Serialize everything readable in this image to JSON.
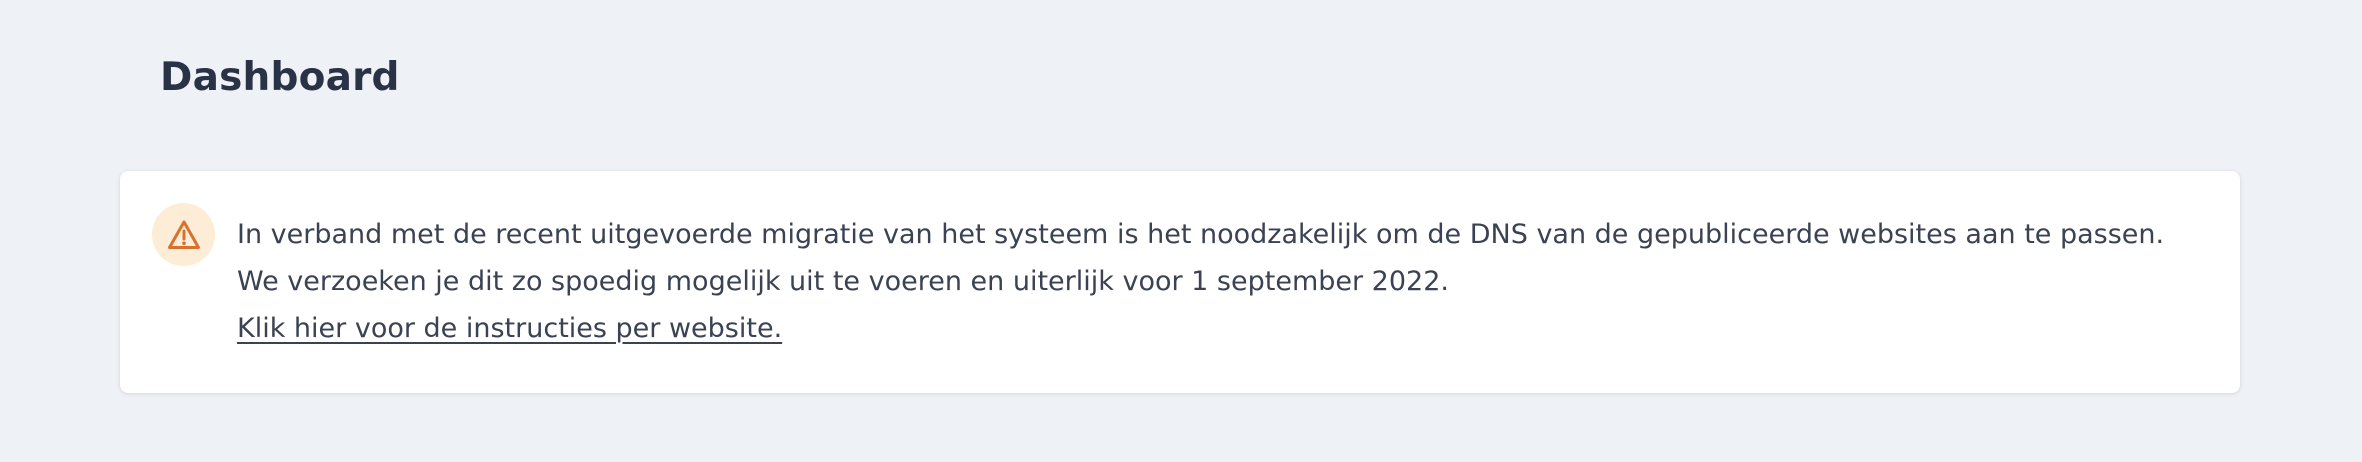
{
  "page": {
    "title": "Dashboard"
  },
  "alert": {
    "icon": "warning-triangle-icon",
    "icon_color": "#d8712e",
    "icon_background": "#fdecd6",
    "message": "In verband met de recent uitgevoerde migratie van het systeem is het noodzakelijk om de DNS van de gepubliceerde websites aan te passen. We verzoeken je dit zo spoedig mogelijk uit te voeren en uiterlijk voor 1 september 2022.",
    "link_label": "Klik hier voor de instructies per website."
  }
}
